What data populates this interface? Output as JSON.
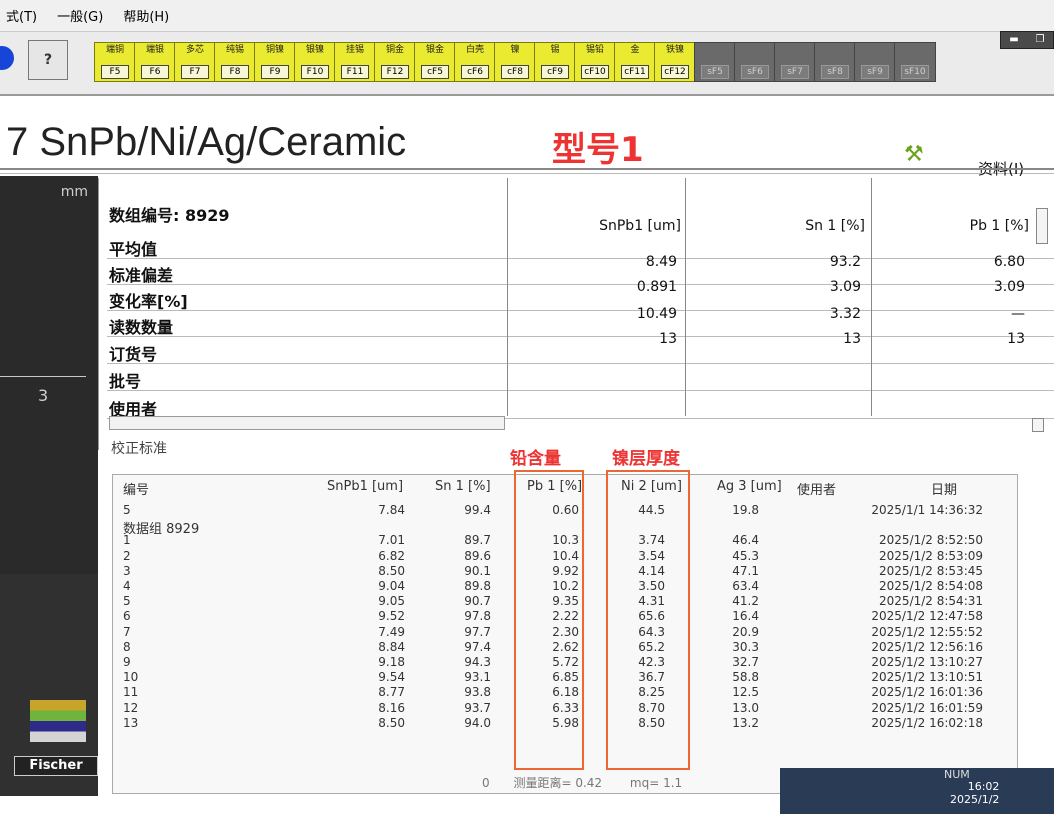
{
  "menu": [
    "式(T)",
    "一般(G)",
    "帮助(H)"
  ],
  "toolbar": {
    "buttons": [
      {
        "label": "端铜",
        "key": "F5"
      },
      {
        "label": "端银",
        "key": "F6"
      },
      {
        "label": "多芯",
        "key": "F7"
      },
      {
        "label": "纯锡",
        "key": "F8"
      },
      {
        "label": "铜镍",
        "key": "F9"
      },
      {
        "label": "银镍",
        "key": "F10"
      },
      {
        "label": "挂锡",
        "key": "F11"
      },
      {
        "label": "铜金",
        "key": "F12"
      },
      {
        "label": "银金",
        "key": "cF5"
      },
      {
        "label": "白壳",
        "key": "cF6"
      },
      {
        "label": "镍",
        "key": "cF8"
      },
      {
        "label": "锡",
        "key": "cF9"
      },
      {
        "label": "锡铅",
        "key": "cF10"
      },
      {
        "label": "金",
        "key": "cF11"
      },
      {
        "label": "铁镍",
        "key": "cF12"
      },
      {
        "label": "",
        "key": "sF5"
      },
      {
        "label": "",
        "key": "sF6"
      },
      {
        "label": "",
        "key": "sF7"
      },
      {
        "label": "",
        "key": "sF8"
      },
      {
        "label": "",
        "key": "sF9"
      },
      {
        "label": "",
        "key": "sF10"
      }
    ]
  },
  "header": {
    "title": "7 SnPb/Ni/Ag/Ceramic",
    "model_label": "型号1",
    "info_label": "资料(I)"
  },
  "left_panel": {
    "unit": "mm",
    "axis_value": "3",
    "brand": "Fischer"
  },
  "summary": {
    "id_label": "数组编号: 8929",
    "row_labels": [
      "平均值",
      "标准偏差",
      "变化率[%]",
      "读数数量",
      "订货号",
      "批号",
      "使用者"
    ],
    "columns": [
      {
        "name": "SnPb1 [um]",
        "values": [
          "8.49",
          "0.891",
          "10.49",
          "13"
        ]
      },
      {
        "name": "Sn 1 [%]",
        "values": [
          "93.2",
          "3.09",
          "3.32",
          "13"
        ]
      },
      {
        "name": "Pb 1 [%]",
        "values": [
          "6.80",
          "3.09",
          "—",
          "13"
        ]
      }
    ],
    "calibration_label": "校正标准"
  },
  "annotations": {
    "lead": "铅含量",
    "nickel": "镍层厚度"
  },
  "data_table": {
    "headers": [
      "编号",
      "SnPb1 [um]",
      "Sn 1 [%]",
      "Pb 1 [%]",
      "Ni 2 [um]",
      "Ag 3 [um]",
      "使用者",
      "日期"
    ],
    "rows": [
      {
        "no": "5",
        "snpb": "7.84",
        "sn": "99.4",
        "pb": "0.60",
        "ni": "44.5",
        "ag": "19.8",
        "date": "2025/1/1 14:36:32"
      },
      {
        "no": "数据组 8929",
        "snpb": "",
        "sn": "",
        "pb": "",
        "ni": "",
        "ag": "",
        "date": ""
      },
      {
        "no": "1",
        "snpb": "7.01",
        "sn": "89.7",
        "pb": "10.3",
        "ni": "3.74",
        "ag": "46.4",
        "date": "2025/1/2 8:52:50"
      },
      {
        "no": "2",
        "snpb": "6.82",
        "sn": "89.6",
        "pb": "10.4",
        "ni": "3.54",
        "ag": "45.3",
        "date": "2025/1/2 8:53:09"
      },
      {
        "no": "3",
        "snpb": "8.50",
        "sn": "90.1",
        "pb": "9.92",
        "ni": "4.14",
        "ag": "47.1",
        "date": "2025/1/2 8:53:45"
      },
      {
        "no": "4",
        "snpb": "9.04",
        "sn": "89.8",
        "pb": "10.2",
        "ni": "3.50",
        "ag": "63.4",
        "date": "2025/1/2 8:54:08"
      },
      {
        "no": "5",
        "snpb": "9.05",
        "sn": "90.7",
        "pb": "9.35",
        "ni": "4.31",
        "ag": "41.2",
        "date": "2025/1/2 8:54:31"
      },
      {
        "no": "6",
        "snpb": "9.52",
        "sn": "97.8",
        "pb": "2.22",
        "ni": "65.6",
        "ag": "16.4",
        "date": "2025/1/2 12:47:58"
      },
      {
        "no": "7",
        "snpb": "7.49",
        "sn": "97.7",
        "pb": "2.30",
        "ni": "64.3",
        "ag": "20.9",
        "date": "2025/1/2 12:55:52"
      },
      {
        "no": "8",
        "snpb": "8.84",
        "sn": "97.4",
        "pb": "2.62",
        "ni": "65.2",
        "ag": "30.3",
        "date": "2025/1/2 12:56:16"
      },
      {
        "no": "9",
        "snpb": "9.18",
        "sn": "94.3",
        "pb": "5.72",
        "ni": "42.3",
        "ag": "32.7",
        "date": "2025/1/2 13:10:27"
      },
      {
        "no": "10",
        "snpb": "9.54",
        "sn": "93.1",
        "pb": "6.85",
        "ni": "36.7",
        "ag": "58.8",
        "date": "2025/1/2 13:10:51"
      },
      {
        "no": "11",
        "snpb": "8.77",
        "sn": "93.8",
        "pb": "6.18",
        "ni": "8.25",
        "ag": "12.5",
        "date": "2025/1/2 16:01:36"
      },
      {
        "no": "12",
        "snpb": "8.16",
        "sn": "93.7",
        "pb": "6.33",
        "ni": "8.70",
        "ag": "13.0",
        "date": "2025/1/2 16:01:59"
      },
      {
        "no": "13",
        "snpb": "8.50",
        "sn": "94.0",
        "pb": "5.98",
        "ni": "8.50",
        "ag": "13.2",
        "date": "2025/1/2 16:02:18"
      }
    ]
  },
  "status": {
    "count": "0",
    "distance": "测量距离= 0.42",
    "mq": "mq= 1.1"
  },
  "taskbar": {
    "num": "NUM",
    "time": "16:02",
    "date": "2025/1/2"
  }
}
